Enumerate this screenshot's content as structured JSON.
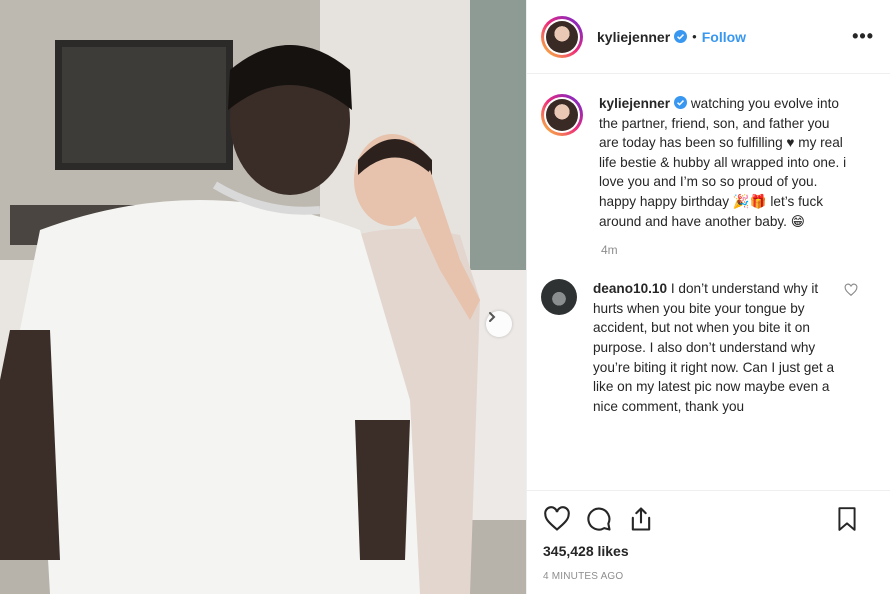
{
  "post": {
    "username": "kyliejenner",
    "follow_label": "Follow",
    "dot": "•",
    "more_label": "•••"
  },
  "caption": {
    "username": "kyliejenner",
    "text": "watching you evolve into the partner, friend, son, and father you are today has been so fulfilling ♥ my real life bestie & hubby all wrapped into one. i love you and I’m so so proud of you. happy happy birthday 🎉🎁 let’s fuck around and have another baby. 😁",
    "time": "4m"
  },
  "comment": {
    "username": "deano10.10",
    "text": "I don’t understand why it hurts when you bite your tongue by accident, but not when you bite it on purpose. I also don’t understand why you’re biting it right now. Can I just get a like on my latest pic now maybe even a nice comment, thank you"
  },
  "footer": {
    "likes": "345,428 likes",
    "ago": "4 MINUTES AGO"
  },
  "icons": {
    "like": "heart-icon",
    "comment": "comment-icon",
    "share": "share-icon",
    "save": "bookmark-icon",
    "next": "chevron-right-icon",
    "verified": "verified-badge-icon"
  },
  "colors": {
    "link": "#3897f0",
    "text": "#262626",
    "muted": "#8e8e8e",
    "border": "#efefef"
  }
}
